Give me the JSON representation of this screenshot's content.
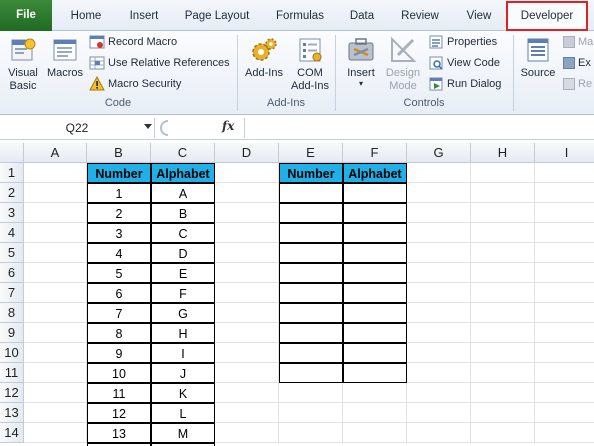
{
  "tabs": {
    "file": "File",
    "home": "Home",
    "insert": "Insert",
    "page_layout": "Page Layout",
    "formulas": "Formulas",
    "data": "Data",
    "review": "Review",
    "view": "View",
    "developer": "Developer"
  },
  "highlight_color": "#e51f1f",
  "ribbon": {
    "code": {
      "label": "Code",
      "visual_basic": [
        "Visual",
        "Basic"
      ],
      "macros": "Macros",
      "record_macro": "Record Macro",
      "use_relative": "Use Relative References",
      "macro_security": "Macro Security"
    },
    "addins": {
      "label": "Add-Ins",
      "addins": "Add-Ins",
      "com_addins": [
        "COM",
        "Add-Ins"
      ]
    },
    "controls": {
      "label": "Controls",
      "insert": "Insert",
      "design_mode": [
        "Design",
        "Mode"
      ],
      "properties": "Properties",
      "view_code": "View Code",
      "run_dialog": "Run Dialog"
    },
    "xml": {
      "source": "Source",
      "map": "Ma",
      "expand": "Ex",
      "refresh": "Re"
    }
  },
  "formula_bar": {
    "name_box": "Q22",
    "fx": "fx",
    "value": ""
  },
  "columns": [
    "A",
    "B",
    "C",
    "D",
    "E",
    "F",
    "G",
    "H",
    "I"
  ],
  "rows": [
    "1",
    "2",
    "3",
    "4",
    "5",
    "6",
    "7",
    "8",
    "9",
    "10",
    "11",
    "12",
    "13",
    "14"
  ],
  "table_left": {
    "headers": [
      "Number",
      "Alphabet"
    ],
    "rows": [
      [
        "1",
        "A"
      ],
      [
        "2",
        "B"
      ],
      [
        "3",
        "C"
      ],
      [
        "4",
        "D"
      ],
      [
        "5",
        "E"
      ],
      [
        "6",
        "F"
      ],
      [
        "7",
        "G"
      ],
      [
        "8",
        "H"
      ],
      [
        "9",
        "I"
      ],
      [
        "10",
        "J"
      ],
      [
        "11",
        "K"
      ],
      [
        "12",
        "L"
      ],
      [
        "13",
        "M"
      ],
      [
        "",
        ""
      ]
    ]
  },
  "table_right": {
    "headers": [
      "Number",
      "Alphabet"
    ],
    "rows": [
      [
        "",
        ""
      ],
      [
        "",
        ""
      ],
      [
        "",
        ""
      ],
      [
        "",
        ""
      ],
      [
        "",
        ""
      ],
      [
        "",
        ""
      ],
      [
        "",
        ""
      ],
      [
        "",
        ""
      ],
      [
        "",
        ""
      ],
      [
        "",
        ""
      ]
    ]
  },
  "header_fill": "#1eb0e6"
}
